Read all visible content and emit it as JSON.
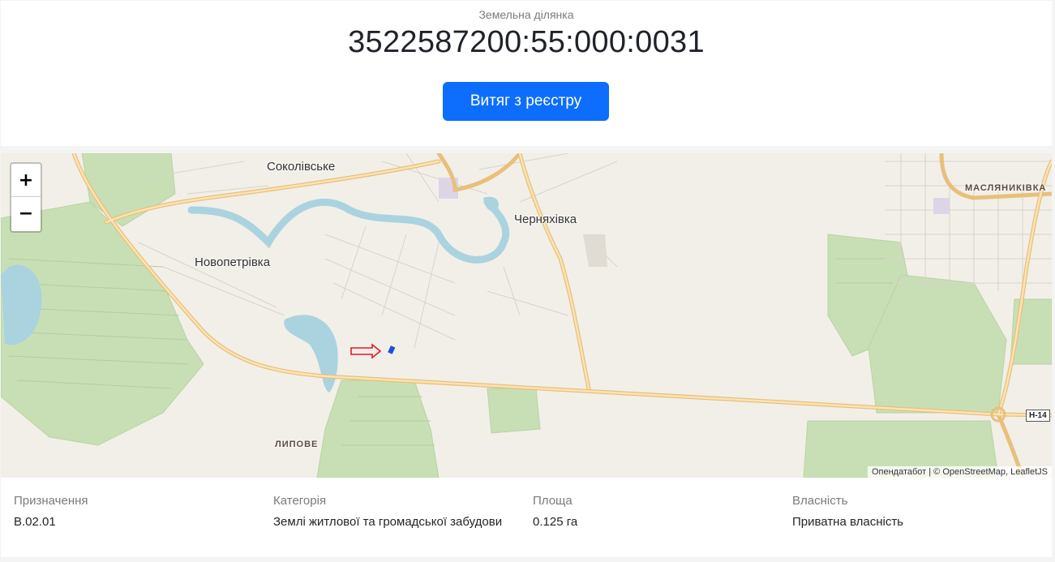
{
  "header": {
    "subtitle": "Земельна ділянка",
    "cadastral_number": "3522587200:55:000:0031",
    "extract_button": "Витяг з реєстру"
  },
  "map": {
    "zoom_in": "+",
    "zoom_out": "−",
    "places": {
      "sokolivske": "Соколівське",
      "cherniakhivka": "Черняхівка",
      "novopetrivka": "Новопетрівка",
      "maslianykivka": "МАСЛЯНИКІВКА",
      "lypove": "ЛИПОВЕ"
    },
    "road_label": "Н-14",
    "attribution": {
      "opendatabot": "Опендатабот",
      "separator": " | © ",
      "osm": "OpenStreetMap",
      "leaflet": "LeafletJS"
    },
    "colors": {
      "background": "#f2efe9",
      "forest": "#c8dfb6",
      "water": "#aad3df",
      "road": "#f7d491",
      "parcel": "#1a4fe0",
      "arrow": "#d62020"
    }
  },
  "info": {
    "purpose_label": "Призначення",
    "purpose_value": "B.02.01",
    "category_label": "Категорія",
    "category_value": "Землі житлової та громадської забудови",
    "area_label": "Площа",
    "area_value": "0.125 га",
    "ownership_label": "Власність",
    "ownership_value": "Приватна власність"
  }
}
